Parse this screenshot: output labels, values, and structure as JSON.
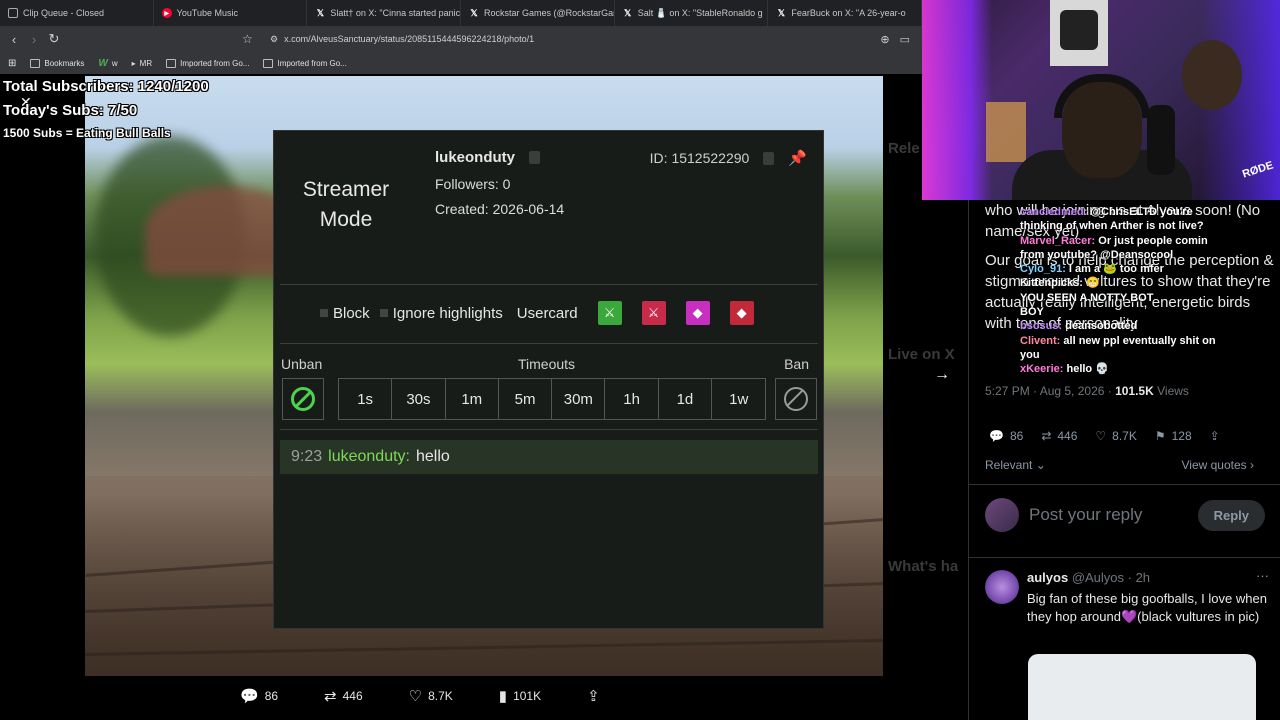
{
  "tabs": [
    {
      "icon": "clip-icon",
      "label": "Clip Queue - Closed"
    },
    {
      "icon": "youtube-icon",
      "label": "YouTube Music"
    },
    {
      "icon": "x-icon",
      "label": "Slatt† on X: \"Cinna started panic"
    },
    {
      "icon": "x-icon",
      "label": "Rockstar Games (@RockstarGames)"
    },
    {
      "icon": "x-icon",
      "label": "Salt 🧂 on X: \"StableRonaldo g"
    },
    {
      "icon": "x-icon",
      "label": "FearBuck on X: \"A 26-year-o"
    }
  ],
  "address": {
    "url": "x.com/AlveusSanctuary/status/2085115444596224218/photo/1"
  },
  "bookmarks": [
    {
      "label": "Bookmarks"
    },
    {
      "label": "w"
    },
    {
      "label": "MR"
    },
    {
      "label": "Imported from Go..."
    },
    {
      "label": "Imported from Go..."
    }
  ],
  "overlay": {
    "total_subs": "Total Subscribers: 1240/1200",
    "todays_subs": "Today's Subs: 7/50",
    "goal": "1500 Subs = Eating Bull Balls"
  },
  "panel": {
    "mode_line1": "Streamer",
    "mode_line2": "Mode",
    "username": "lukeonduty",
    "followers": "Followers: 0",
    "created": "Created: 2026-06-14",
    "id": "ID: 1512522290",
    "block_label": "Block",
    "ignore_label": "Ignore highlights",
    "usercard_label": "Usercard",
    "unban_label": "Unban",
    "timeouts_label": "Timeouts",
    "ban_label": "Ban",
    "timeouts": [
      "1s",
      "30s",
      "1m",
      "5m",
      "30m",
      "1h",
      "1d",
      "1w"
    ],
    "message": {
      "time": "9:23",
      "user": "lukeonduty:",
      "text": "hello"
    },
    "colors": {
      "mod": "#4bd34b",
      "vip": "#c82a4a",
      "sub": "#c72fbf",
      "gift": "#c22a3a"
    }
  },
  "photo_actions": [
    {
      "icon": "reply-icon",
      "value": "86"
    },
    {
      "icon": "retweet-icon",
      "value": "446"
    },
    {
      "icon": "like-icon",
      "value": "8.7K"
    },
    {
      "icon": "views-icon",
      "value": "101K"
    },
    {
      "icon": "share-icon",
      "value": ""
    }
  ],
  "post": {
    "text_1": "who will be joining us at Alveus soon! (No name/sex yet)",
    "text_2": "Our goal is to help change the perception & stigma around vultures to show that they're actually really intelligent, energetic birds with tons of personality",
    "time": "5:27 PM · Aug 5, 2026 · ",
    "views": "101.5K",
    "views_label": "Views",
    "stats": [
      {
        "icon": "reply-icon",
        "value": "86"
      },
      {
        "icon": "retweet-icon",
        "value": "446"
      },
      {
        "icon": "like-icon",
        "value": "8.7K"
      },
      {
        "icon": "bookmark-icon",
        "value": "128"
      },
      {
        "icon": "share-icon",
        "value": ""
      }
    ],
    "relevant": "Relevant",
    "view_quotes": "View quotes",
    "reply_placeholder": "Post your reply",
    "reply_button": "Reply"
  },
  "reply": {
    "name": "aulyos",
    "handle": "@Aulyos · 2h",
    "text": "Big fan of these big goofballs, I love when they hop around💜(black vultures in pic)"
  },
  "chat": [
    {
      "user": "cancledmed:",
      "text": "@ChrisELTD you're"
    },
    {
      "user": "",
      "text": "thinking of when Arther is not live?"
    },
    {
      "user": "Marvel_Racer:",
      "text": "Or just people comin"
    },
    {
      "user": "",
      "text": "from youtube? @Deansocool"
    },
    {
      "user": "Cylo_91:",
      "text": "I am a 🐸 too mfer"
    },
    {
      "user": "",
      "text": "Kittenpicks: 😁"
    },
    {
      "user": "",
      "text": "YOU SEEN A NOTTY BOT"
    },
    {
      "user": "",
      "text": "BOY"
    },
    {
      "user": "bsosus:",
      "text": "deansobotted"
    },
    {
      "user": "Clivent:",
      "text": "all new ppl eventually shit on"
    },
    {
      "user": "",
      "text": "you"
    },
    {
      "user": "xKeerie:",
      "text": "hello 💀"
    }
  ]
}
